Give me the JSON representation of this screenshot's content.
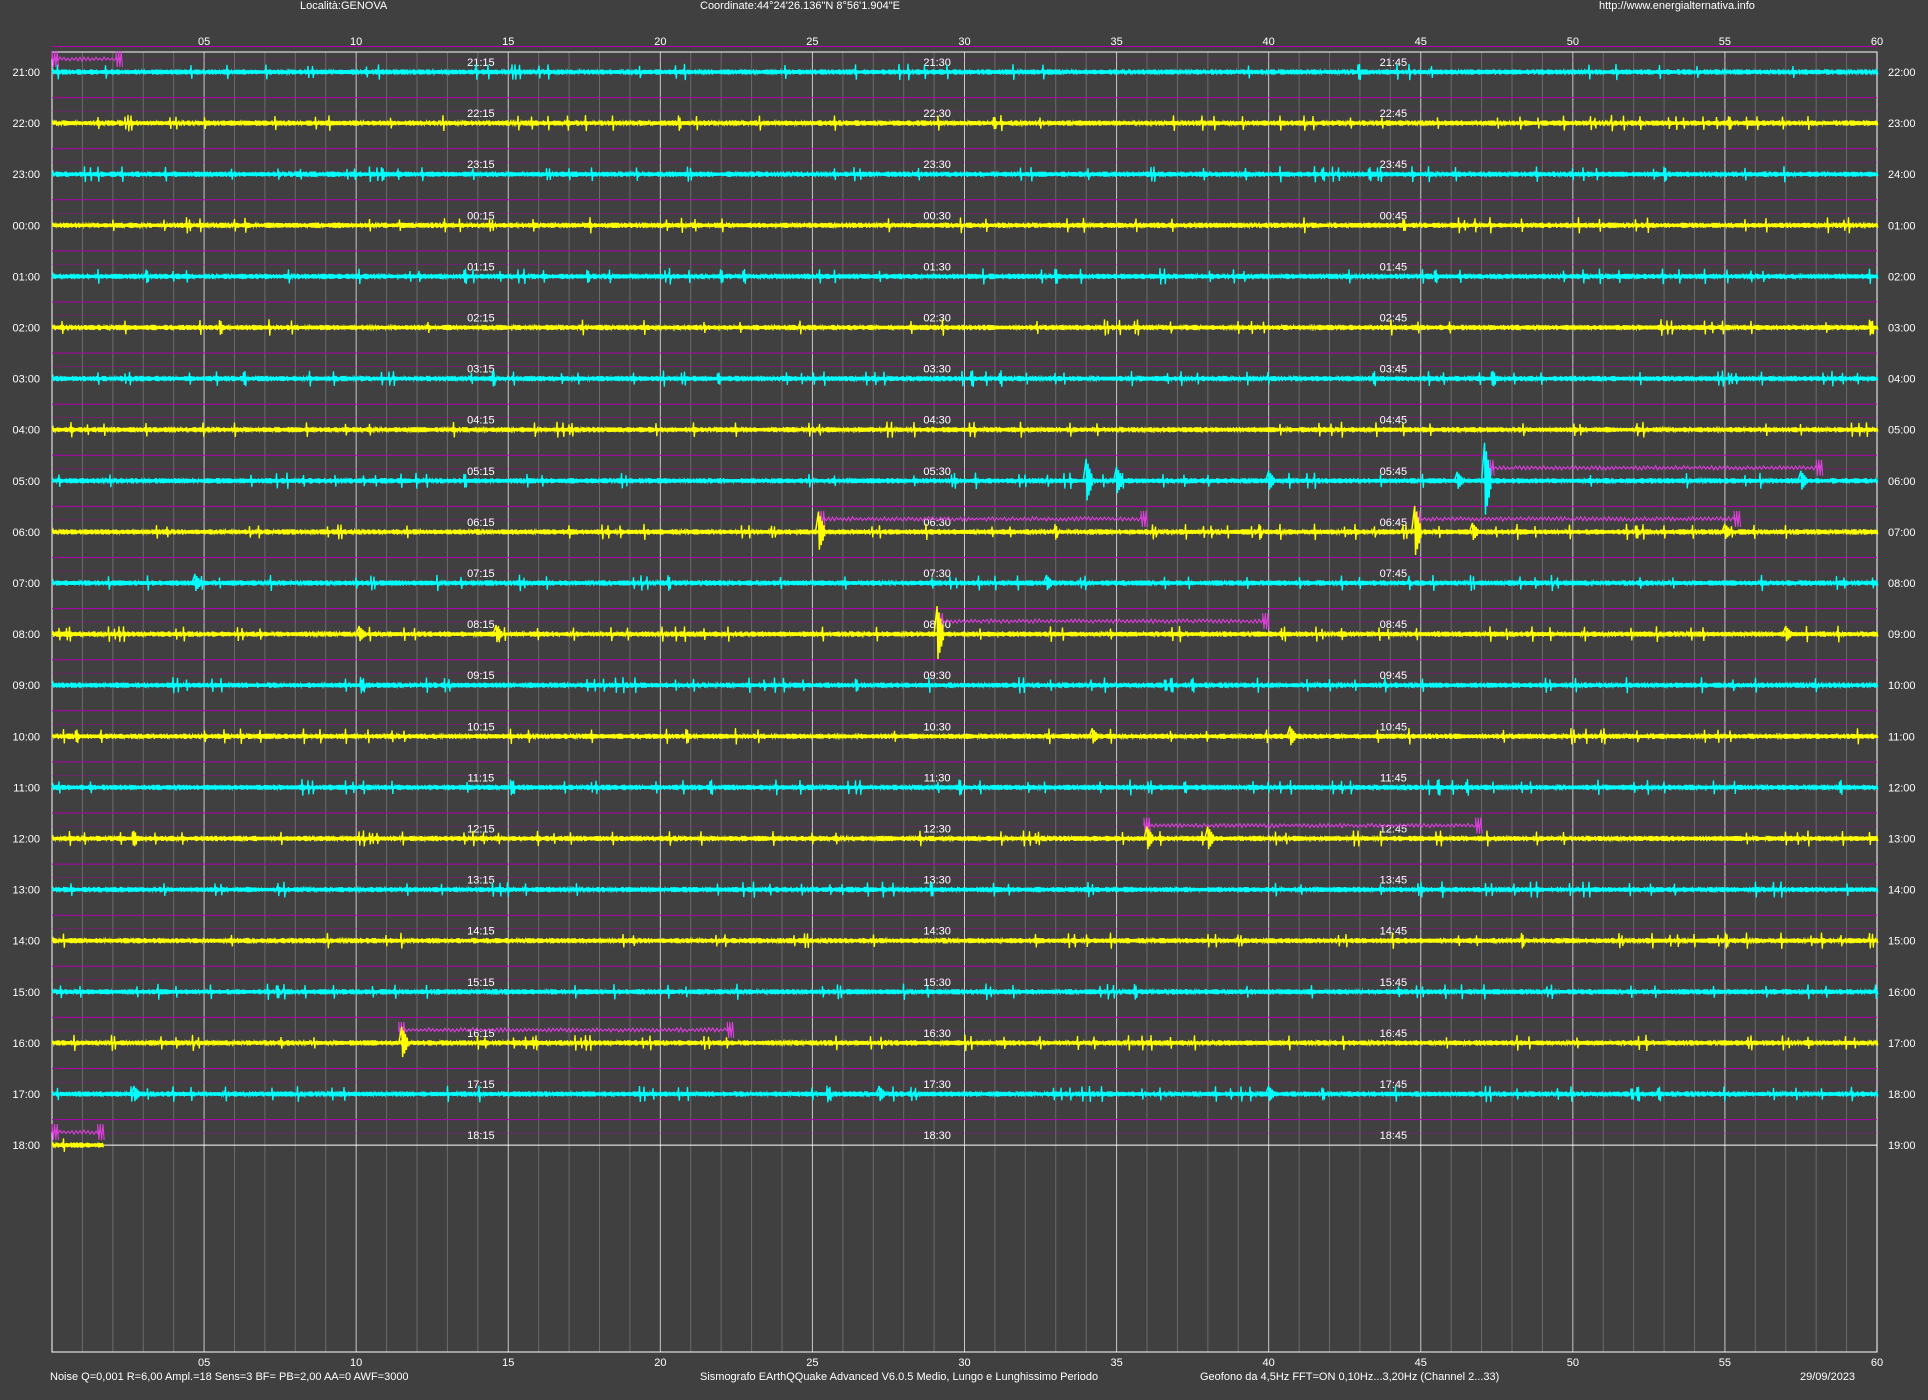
{
  "header": {
    "location": "Località:GENOVA",
    "coordinates": "Coordinate:44°24'26.136\"N  8°56'1.904\"E",
    "url": "http://www.energialternativa.info"
  },
  "footer": {
    "params": "Noise Q=0,001 R=6,00 Ampl.=18 Sens=3 BF= PB=2,00 AA=0 AWF=3000",
    "software": "Sismografo  EArthQQuake Advanced V6.0.5  Medio, Lungo e Lunghissimo Periodo",
    "sensor": "Geofono da 4,5Hz FFT=ON 0,10Hz...3,20Hz      (Channel 2...33)",
    "date": "29/09/2023"
  },
  "x_axis": {
    "minute_ticks": [
      "05",
      "10",
      "15",
      "20",
      "25",
      "30",
      "35",
      "40",
      "45",
      "50",
      "55",
      "60"
    ]
  },
  "colors": {
    "background": "#404040",
    "plot_border": "#ffffff",
    "major_grid": "#c8c8c8",
    "minor_grid": "#6a6a6a",
    "separator": "#b000b0",
    "trace_a": "#00ffff",
    "trace_b": "#ffff00",
    "secondary_trace": "#e040e0"
  },
  "rows": [
    {
      "left": "21:00",
      "right": "22:00",
      "q1": "21:15",
      "q2": "21:30",
      "q3": "21:45",
      "color": "#00ffff"
    },
    {
      "left": "22:00",
      "right": "23:00",
      "q1": "22:15",
      "q2": "22:30",
      "q3": "22:45",
      "color": "#ffff00"
    },
    {
      "left": "23:00",
      "right": "24:00",
      "q1": "23:15",
      "q2": "23:30",
      "q3": "23:45",
      "color": "#00ffff"
    },
    {
      "left": "00:00",
      "right": "01:00",
      "q1": "00:15",
      "q2": "00:30",
      "q3": "00:45",
      "color": "#ffff00"
    },
    {
      "left": "01:00",
      "right": "02:00",
      "q1": "01:15",
      "q2": "01:30",
      "q3": "01:45",
      "color": "#00ffff"
    },
    {
      "left": "02:00",
      "right": "03:00",
      "q1": "02:15",
      "q2": "02:30",
      "q3": "02:45",
      "color": "#ffff00"
    },
    {
      "left": "03:00",
      "right": "04:00",
      "q1": "03:15",
      "q2": "03:30",
      "q3": "03:45",
      "color": "#00ffff"
    },
    {
      "left": "04:00",
      "right": "05:00",
      "q1": "04:15",
      "q2": "04:30",
      "q3": "04:45",
      "color": "#ffff00"
    },
    {
      "left": "05:00",
      "right": "06:00",
      "q1": "05:15",
      "q2": "05:30",
      "q3": "05:45",
      "color": "#00ffff"
    },
    {
      "left": "06:00",
      "right": "07:00",
      "q1": "06:15",
      "q2": "06:30",
      "q3": "06:45",
      "color": "#ffff00"
    },
    {
      "left": "07:00",
      "right": "08:00",
      "q1": "07:15",
      "q2": "07:30",
      "q3": "07:45",
      "color": "#00ffff"
    },
    {
      "left": "08:00",
      "right": "09:00",
      "q1": "08:15",
      "q2": "08:30",
      "q3": "08:45",
      "color": "#ffff00"
    },
    {
      "left": "09:00",
      "right": "10:00",
      "q1": "09:15",
      "q2": "09:30",
      "q3": "09:45",
      "color": "#00ffff"
    },
    {
      "left": "10:00",
      "right": "11:00",
      "q1": "10:15",
      "q2": "10:30",
      "q3": "10:45",
      "color": "#ffff00"
    },
    {
      "left": "11:00",
      "right": "12:00",
      "q1": "11:15",
      "q2": "11:30",
      "q3": "11:45",
      "color": "#00ffff"
    },
    {
      "left": "12:00",
      "right": "13:00",
      "q1": "12:15",
      "q2": "12:30",
      "q3": "12:45",
      "color": "#ffff00"
    },
    {
      "left": "13:00",
      "right": "14:00",
      "q1": "13:15",
      "q2": "13:30",
      "q3": "13:45",
      "color": "#00ffff"
    },
    {
      "left": "14:00",
      "right": "15:00",
      "q1": "14:15",
      "q2": "14:30",
      "q3": "14:45",
      "color": "#ffff00"
    },
    {
      "left": "15:00",
      "right": "16:00",
      "q1": "15:15",
      "q2": "15:30",
      "q3": "15:45",
      "color": "#00ffff"
    },
    {
      "left": "16:00",
      "right": "17:00",
      "q1": "16:15",
      "q2": "16:30",
      "q3": "16:45",
      "color": "#ffff00"
    },
    {
      "left": "17:00",
      "right": "18:00",
      "q1": "17:15",
      "q2": "17:30",
      "q3": "17:45",
      "color": "#00ffff"
    },
    {
      "left": "18:00",
      "right": "19:00",
      "q1": "18:15",
      "q2": "18:30",
      "q3": "18:45",
      "color": "#ffff00",
      "partial_until_minute": 1.7
    }
  ],
  "events": [
    {
      "row": 8,
      "minute": 34.0,
      "amp": 22
    },
    {
      "row": 8,
      "minute": 35.0,
      "amp": 14
    },
    {
      "row": 8,
      "minute": 40.0,
      "amp": 10
    },
    {
      "row": 8,
      "minute": 46.2,
      "amp": 9
    },
    {
      "row": 8,
      "minute": 47.1,
      "amp": 38
    },
    {
      "row": 8,
      "minute": 57.5,
      "amp": 10
    },
    {
      "row": 9,
      "minute": 25.2,
      "amp": 20
    },
    {
      "row": 9,
      "minute": 44.8,
      "amp": 26
    },
    {
      "row": 9,
      "minute": 46.7,
      "amp": 9
    },
    {
      "row": 9,
      "minute": 55.0,
      "amp": 8
    },
    {
      "row": 10,
      "minute": 4.7,
      "amp": 9
    },
    {
      "row": 10,
      "minute": 32.7,
      "amp": 8
    },
    {
      "row": 11,
      "minute": 10.1,
      "amp": 8
    },
    {
      "row": 11,
      "minute": 14.6,
      "amp": 9
    },
    {
      "row": 11,
      "minute": 29.1,
      "amp": 28
    },
    {
      "row": 11,
      "minute": 57.0,
      "amp": 8
    },
    {
      "row": 13,
      "minute": 34.2,
      "amp": 8
    },
    {
      "row": 13,
      "minute": 40.7,
      "amp": 10
    },
    {
      "row": 15,
      "minute": 36.0,
      "amp": 12
    },
    {
      "row": 15,
      "minute": 38.0,
      "amp": 12
    },
    {
      "row": 19,
      "minute": 11.5,
      "amp": 16
    },
    {
      "row": 20,
      "minute": 2.7,
      "amp": 8
    },
    {
      "row": 20,
      "minute": 27.2,
      "amp": 8
    },
    {
      "row": 20,
      "minute": 40.0,
      "amp": 8
    }
  ],
  "secondary_traces": [
    {
      "row": 8,
      "start": 47.2,
      "end": 58.2
    },
    {
      "row": 9,
      "start": 25.2,
      "end": 36.0
    },
    {
      "row": 9,
      "start": 44.8,
      "end": 55.5
    },
    {
      "row": 11,
      "start": 29.1,
      "end": 40.0
    },
    {
      "row": 15,
      "start": 35.9,
      "end": 47.0
    },
    {
      "row": 19,
      "start": 11.4,
      "end": 22.4
    },
    {
      "row": 0,
      "start": 0.0,
      "end": 2.3
    },
    {
      "row": 21,
      "start": 0.0,
      "end": 1.7
    }
  ]
}
